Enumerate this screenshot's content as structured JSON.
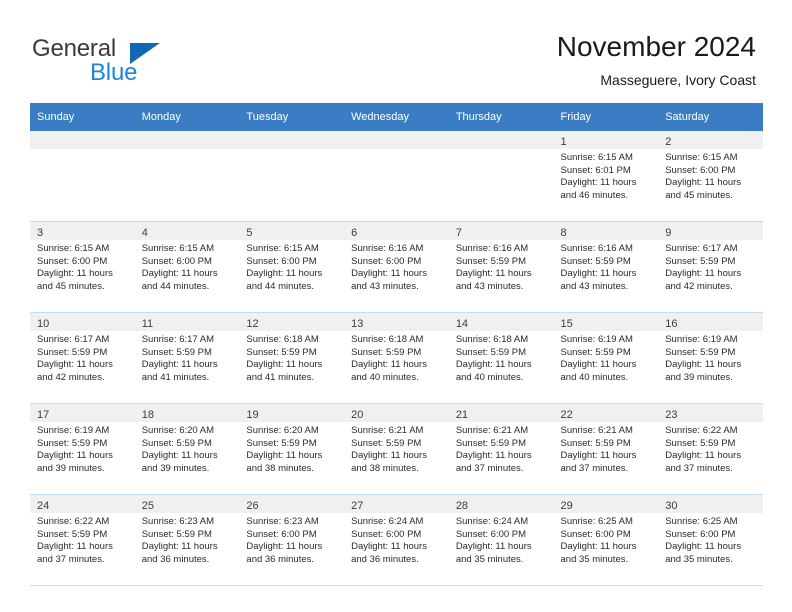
{
  "brand": {
    "line1": "General",
    "line2": "Blue",
    "triangle_icon": "brand-triangle-icon"
  },
  "header": {
    "title": "November 2024",
    "subtitle": "Masseguere, Ivory Coast"
  },
  "colors": {
    "header_band": "#3a7dc4",
    "daynum_band": "#f0f0f0",
    "brand_blue": "#1f86d8",
    "brand_triangle": "#1268b3",
    "row_divider": "#c8dcf0",
    "text": "#2b2b2b"
  },
  "weekdays": [
    "Sunday",
    "Monday",
    "Tuesday",
    "Wednesday",
    "Thursday",
    "Friday",
    "Saturday"
  ],
  "labels": {
    "sunrise_prefix": "Sunrise:",
    "sunset_prefix": "Sunset:",
    "daylight_prefix": "Daylight:"
  },
  "weeks": [
    [
      {
        "day": "",
        "empty": true
      },
      {
        "day": "",
        "empty": true
      },
      {
        "day": "",
        "empty": true
      },
      {
        "day": "",
        "empty": true
      },
      {
        "day": "",
        "empty": true
      },
      {
        "day": "1",
        "sunrise": "Sunrise: 6:15 AM",
        "sunset": "Sunset: 6:01 PM",
        "daylight_1": "Daylight: 11 hours",
        "daylight_2": "and 46 minutes."
      },
      {
        "day": "2",
        "sunrise": "Sunrise: 6:15 AM",
        "sunset": "Sunset: 6:00 PM",
        "daylight_1": "Daylight: 11 hours",
        "daylight_2": "and 45 minutes."
      }
    ],
    [
      {
        "day": "3",
        "sunrise": "Sunrise: 6:15 AM",
        "sunset": "Sunset: 6:00 PM",
        "daylight_1": "Daylight: 11 hours",
        "daylight_2": "and 45 minutes."
      },
      {
        "day": "4",
        "sunrise": "Sunrise: 6:15 AM",
        "sunset": "Sunset: 6:00 PM",
        "daylight_1": "Daylight: 11 hours",
        "daylight_2": "and 44 minutes."
      },
      {
        "day": "5",
        "sunrise": "Sunrise: 6:15 AM",
        "sunset": "Sunset: 6:00 PM",
        "daylight_1": "Daylight: 11 hours",
        "daylight_2": "and 44 minutes."
      },
      {
        "day": "6",
        "sunrise": "Sunrise: 6:16 AM",
        "sunset": "Sunset: 6:00 PM",
        "daylight_1": "Daylight: 11 hours",
        "daylight_2": "and 43 minutes."
      },
      {
        "day": "7",
        "sunrise": "Sunrise: 6:16 AM",
        "sunset": "Sunset: 5:59 PM",
        "daylight_1": "Daylight: 11 hours",
        "daylight_2": "and 43 minutes."
      },
      {
        "day": "8",
        "sunrise": "Sunrise: 6:16 AM",
        "sunset": "Sunset: 5:59 PM",
        "daylight_1": "Daylight: 11 hours",
        "daylight_2": "and 43 minutes."
      },
      {
        "day": "9",
        "sunrise": "Sunrise: 6:17 AM",
        "sunset": "Sunset: 5:59 PM",
        "daylight_1": "Daylight: 11 hours",
        "daylight_2": "and 42 minutes."
      }
    ],
    [
      {
        "day": "10",
        "sunrise": "Sunrise: 6:17 AM",
        "sunset": "Sunset: 5:59 PM",
        "daylight_1": "Daylight: 11 hours",
        "daylight_2": "and 42 minutes."
      },
      {
        "day": "11",
        "sunrise": "Sunrise: 6:17 AM",
        "sunset": "Sunset: 5:59 PM",
        "daylight_1": "Daylight: 11 hours",
        "daylight_2": "and 41 minutes."
      },
      {
        "day": "12",
        "sunrise": "Sunrise: 6:18 AM",
        "sunset": "Sunset: 5:59 PM",
        "daylight_1": "Daylight: 11 hours",
        "daylight_2": "and 41 minutes."
      },
      {
        "day": "13",
        "sunrise": "Sunrise: 6:18 AM",
        "sunset": "Sunset: 5:59 PM",
        "daylight_1": "Daylight: 11 hours",
        "daylight_2": "and 40 minutes."
      },
      {
        "day": "14",
        "sunrise": "Sunrise: 6:18 AM",
        "sunset": "Sunset: 5:59 PM",
        "daylight_1": "Daylight: 11 hours",
        "daylight_2": "and 40 minutes."
      },
      {
        "day": "15",
        "sunrise": "Sunrise: 6:19 AM",
        "sunset": "Sunset: 5:59 PM",
        "daylight_1": "Daylight: 11 hours",
        "daylight_2": "and 40 minutes."
      },
      {
        "day": "16",
        "sunrise": "Sunrise: 6:19 AM",
        "sunset": "Sunset: 5:59 PM",
        "daylight_1": "Daylight: 11 hours",
        "daylight_2": "and 39 minutes."
      }
    ],
    [
      {
        "day": "17",
        "sunrise": "Sunrise: 6:19 AM",
        "sunset": "Sunset: 5:59 PM",
        "daylight_1": "Daylight: 11 hours",
        "daylight_2": "and 39 minutes."
      },
      {
        "day": "18",
        "sunrise": "Sunrise: 6:20 AM",
        "sunset": "Sunset: 5:59 PM",
        "daylight_1": "Daylight: 11 hours",
        "daylight_2": "and 39 minutes."
      },
      {
        "day": "19",
        "sunrise": "Sunrise: 6:20 AM",
        "sunset": "Sunset: 5:59 PM",
        "daylight_1": "Daylight: 11 hours",
        "daylight_2": "and 38 minutes."
      },
      {
        "day": "20",
        "sunrise": "Sunrise: 6:21 AM",
        "sunset": "Sunset: 5:59 PM",
        "daylight_1": "Daylight: 11 hours",
        "daylight_2": "and 38 minutes."
      },
      {
        "day": "21",
        "sunrise": "Sunrise: 6:21 AM",
        "sunset": "Sunset: 5:59 PM",
        "daylight_1": "Daylight: 11 hours",
        "daylight_2": "and 37 minutes."
      },
      {
        "day": "22",
        "sunrise": "Sunrise: 6:21 AM",
        "sunset": "Sunset: 5:59 PM",
        "daylight_1": "Daylight: 11 hours",
        "daylight_2": "and 37 minutes."
      },
      {
        "day": "23",
        "sunrise": "Sunrise: 6:22 AM",
        "sunset": "Sunset: 5:59 PM",
        "daylight_1": "Daylight: 11 hours",
        "daylight_2": "and 37 minutes."
      }
    ],
    [
      {
        "day": "24",
        "sunrise": "Sunrise: 6:22 AM",
        "sunset": "Sunset: 5:59 PM",
        "daylight_1": "Daylight: 11 hours",
        "daylight_2": "and 37 minutes."
      },
      {
        "day": "25",
        "sunrise": "Sunrise: 6:23 AM",
        "sunset": "Sunset: 5:59 PM",
        "daylight_1": "Daylight: 11 hours",
        "daylight_2": "and 36 minutes."
      },
      {
        "day": "26",
        "sunrise": "Sunrise: 6:23 AM",
        "sunset": "Sunset: 6:00 PM",
        "daylight_1": "Daylight: 11 hours",
        "daylight_2": "and 36 minutes."
      },
      {
        "day": "27",
        "sunrise": "Sunrise: 6:24 AM",
        "sunset": "Sunset: 6:00 PM",
        "daylight_1": "Daylight: 11 hours",
        "daylight_2": "and 36 minutes."
      },
      {
        "day": "28",
        "sunrise": "Sunrise: 6:24 AM",
        "sunset": "Sunset: 6:00 PM",
        "daylight_1": "Daylight: 11 hours",
        "daylight_2": "and 35 minutes."
      },
      {
        "day": "29",
        "sunrise": "Sunrise: 6:25 AM",
        "sunset": "Sunset: 6:00 PM",
        "daylight_1": "Daylight: 11 hours",
        "daylight_2": "and 35 minutes."
      },
      {
        "day": "30",
        "sunrise": "Sunrise: 6:25 AM",
        "sunset": "Sunset: 6:00 PM",
        "daylight_1": "Daylight: 11 hours",
        "daylight_2": "and 35 minutes."
      }
    ]
  ]
}
